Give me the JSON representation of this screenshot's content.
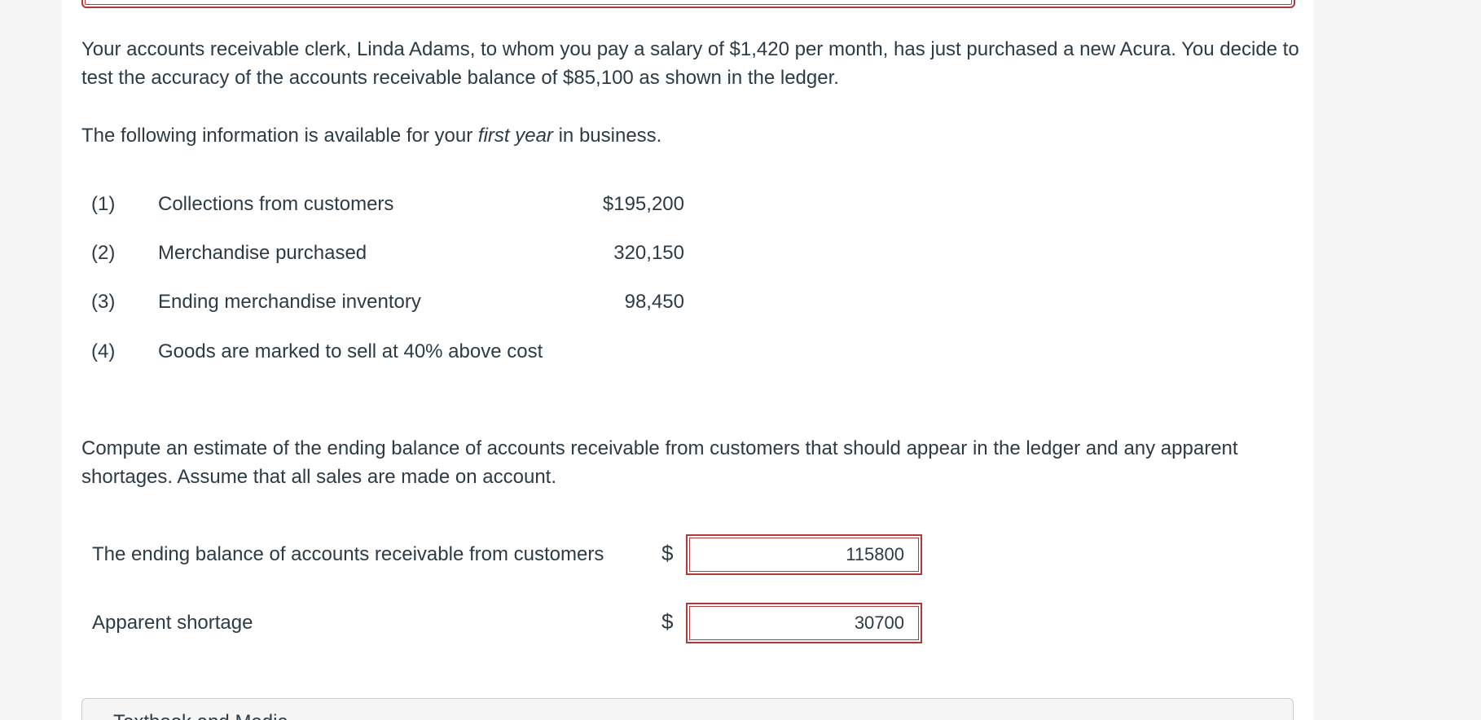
{
  "problem": {
    "paragraph1": "Your accounts receivable clerk, Linda Adams, to whom you pay a salary of $1,420 per month, has just purchased a new Acura. You decide to test the accuracy of the accounts receivable balance of $85,100 as shown in the ledger.",
    "paragraph2_before": "The following information is available for your ",
    "paragraph2_italic": "first year",
    "paragraph2_after": " in business.",
    "items": [
      {
        "num": "(1)",
        "desc": "Collections from customers",
        "amount": "$195,200"
      },
      {
        "num": "(2)",
        "desc": "Merchandise purchased",
        "amount": "320,150"
      },
      {
        "num": "(3)",
        "desc": "Ending merchandise inventory",
        "amount": "98,450"
      },
      {
        "num": "(4)",
        "desc": "Goods are marked to sell at 40% above cost",
        "amount": ""
      }
    ],
    "paragraph3": "Compute an estimate of the ending balance of accounts receivable from customers that should appear in the ledger and any apparent shortages. Assume that all sales are made on account."
  },
  "answers": [
    {
      "label": "The ending balance of accounts receivable from customers",
      "currency": "$",
      "value": "115800"
    },
    {
      "label": "Apparent shortage",
      "currency": "$",
      "value": "30700"
    }
  ],
  "bottom_panel": {
    "title": "Textbook and Media"
  }
}
